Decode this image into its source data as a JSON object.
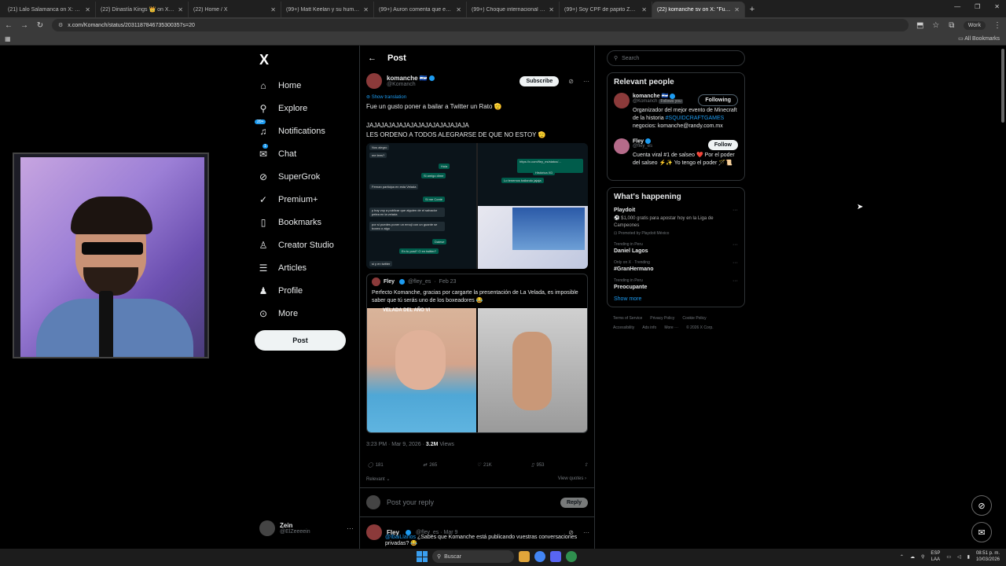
{
  "browser": {
    "tabs": [
      {
        "label": "(21) Lalo Salamanca on X: \"💀…",
        "active": false
      },
      {
        "label": "(22) Dinastía Kings 👑 on X: \"…",
        "active": false
      },
      {
        "label": "(22) Home / X",
        "active": false
      },
      {
        "label": "(99+) Matt Keelan y su humor …",
        "active": false
      },
      {
        "label": "(99+) Auron comenta que en la…",
        "active": false
      },
      {
        "label": "(99+) Choque internacional po…",
        "active": false
      },
      {
        "label": "(99+) Soy CPF de papito Zein…",
        "active": false
      },
      {
        "label": "(22) komanche sv on X: \"Fue un…",
        "active": true
      }
    ],
    "url": "x.com/Komanch/status/2031187846735300357s=20",
    "profile": "Work",
    "all_bookmarks": "All Bookmarks"
  },
  "sidebar": {
    "logo": "X",
    "items": [
      {
        "label": "Home",
        "icon": "home-icon"
      },
      {
        "label": "Explore",
        "icon": "search-icon"
      },
      {
        "label": "Notifications",
        "icon": "bell-icon",
        "badge": "20+"
      },
      {
        "label": "Chat",
        "icon": "mail-icon",
        "badge": "1"
      },
      {
        "label": "SuperGrok",
        "icon": "grok-icon"
      },
      {
        "label": "Premium+",
        "icon": "premium-icon"
      },
      {
        "label": "Bookmarks",
        "icon": "bookmark-icon"
      },
      {
        "label": "Creator Studio",
        "icon": "studio-icon"
      },
      {
        "label": "Articles",
        "icon": "articles-icon"
      },
      {
        "label": "Profile",
        "icon": "profile-icon"
      },
      {
        "label": "More",
        "icon": "more-icon"
      }
    ],
    "post_button": "Post",
    "account": {
      "name": "Zein",
      "handle": "@ElZeeeein"
    }
  },
  "main": {
    "header_title": "Post",
    "post": {
      "name": "komanche 🇸🇻",
      "handle": "@Komanch",
      "subscribe": "Subscribe",
      "show_translation": "Show translation",
      "text": "Fue un gusto poner a bailar a Twitter un Rato 🫡\n\nJAJAJAJAJAJAJAJAJAJAJAJAJAJA\nLES ORDENO A TODOS ALEGRARSE DE QUE NO ESTOY 🫡",
      "chat_messages": [
        {
          "text": "Hola",
          "side": "out"
        },
        {
          "text": "Si amigo dime",
          "side": "out"
        },
        {
          "text": "Fernan participa en esta Velada",
          "side": "in"
        },
        {
          "text": "Si me Conté",
          "side": "out"
        },
        {
          "text": "y hoy voy a publicar que alguien de el salvador pelea en la velada",
          "side": "in"
        },
        {
          "text": "por si puedes poner un emoji con un guante se boxeo o algo",
          "side": "in"
        },
        {
          "text": "Dalese",
          "side": "out"
        },
        {
          "text": "En tu post? O en twitter?",
          "side": "out"
        },
        {
          "text": "si y en twitter",
          "side": "in"
        },
        {
          "text": "Histórica XD",
          "side": "out"
        },
        {
          "text": "Lo tenemos bailando jajaja",
          "side": "out"
        }
      ],
      "quote": {
        "name": "Fley",
        "handle": "@fley_es",
        "date": "Feb 23",
        "text": "Perfecto Komanche, gracias por cargarte la presentación de La Velada, es imposible saber que tú serás uno de los boxeadores 😂",
        "media_label": "VELADA DEL AÑO VI"
      },
      "time": "3:23 PM · Mar 9, 2026 · ",
      "views_count": "3.2M",
      "views_label": " Views",
      "stats": {
        "replies": "181",
        "reposts": "265",
        "likes": "21K",
        "bookmarks": "953"
      },
      "relevant": "Relevant ⌄",
      "view_quotes": "View quotes ›"
    },
    "reply_placeholder": "Post your reply",
    "reply_button": "Reply",
    "next_reply": {
      "name": "Fley",
      "handle": "@fley_es · Mar 9",
      "mention": "@IbaiLlanos",
      "text": " ¿Sabes que Komanche está publicando vuestras conversaciones privadas? 😂"
    }
  },
  "right": {
    "search_placeholder": "Search",
    "relevant_title": "Relevant people",
    "people": [
      {
        "name": "komanche 🇸🇻",
        "handle": "@Komanch",
        "follows_you": "Follows you",
        "button": "Following",
        "bio": "Organizador del mejor evento de Minecraft de la historia ",
        "bio_link": "#SQUIDCRAFTGAMES",
        "bio_end": " negocios: komanche@randy.com.mx"
      },
      {
        "name": "Fley",
        "handle": "@fley_es",
        "button": "Follow",
        "bio": "Cuenta viral #1 de salseo ❤️ Por el poder del salseo ⚡✨ Yo tengo el poder 🪄📜"
      }
    ],
    "happening_title": "What's happening",
    "trends": [
      {
        "context": "",
        "title": "Playdoit",
        "desc": "⚽ $1,000 gratis para apostar hoy en la Liga de Campeones",
        "promo": "Promoted by Playdoit México"
      },
      {
        "context": "Trending in Peru",
        "title": "Daniel Lagos"
      },
      {
        "context": "Only on X · Trending",
        "title": "#GranHermano"
      },
      {
        "context": "Trending in Peru",
        "title": "Preocupante"
      }
    ],
    "show_more": "Show more",
    "footer": [
      "Terms of Service",
      "Privacy Policy",
      "Cookie Policy",
      "Accessibility",
      "Ads info",
      "More ···",
      "© 2026 X Corp."
    ]
  },
  "taskbar": {
    "search": "Buscar",
    "lang": "ESP",
    "lang2": "LAA",
    "time": "08:51 p. m.",
    "date": "10/03/2026"
  }
}
